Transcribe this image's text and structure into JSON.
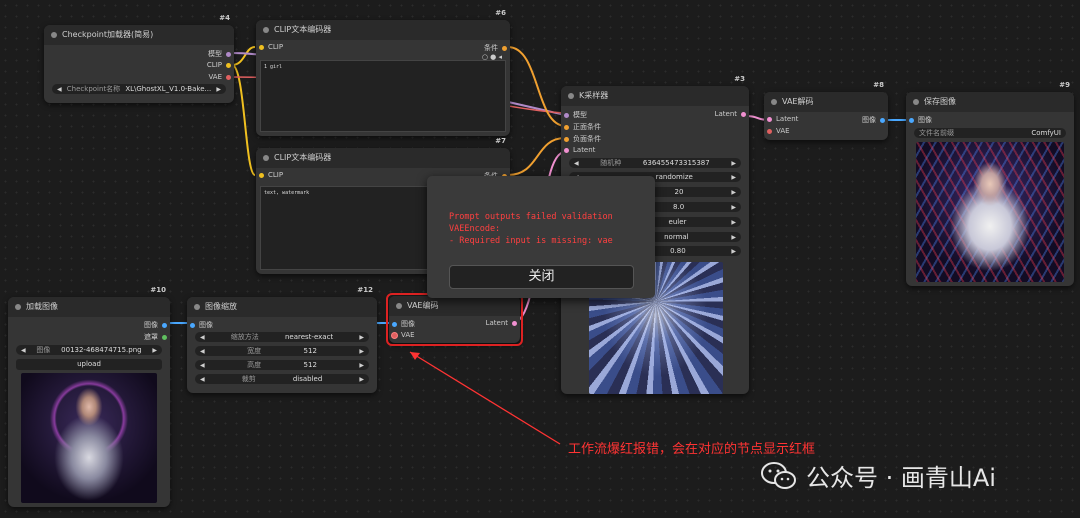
{
  "nodes": {
    "checkpoint": {
      "id": "#4",
      "title": "Checkpoint加载器(简易)",
      "outputs": [
        "模型",
        "CLIP",
        "VAE"
      ],
      "widget": {
        "label": "Checkpoint名称",
        "value": "XL\\GhostXL_V1.0-Bake..."
      }
    },
    "clip1": {
      "id": "#6",
      "title": "CLIP文本编码器",
      "input": "CLIP",
      "output": "条件",
      "text": "1 girl"
    },
    "clip2": {
      "id": "#7",
      "title": "CLIP文本编码器",
      "input": "CLIP",
      "output": "条件",
      "text": "text, watermark"
    },
    "ksampler": {
      "id": "#3",
      "title": "K采样器",
      "inputs": [
        "模型",
        "正面条件",
        "负面条件",
        "Latent"
      ],
      "output": "Latent",
      "widgets": [
        {
          "label": "随机种",
          "value": "636455473315387"
        },
        {
          "label": "",
          "value": "randomize"
        },
        {
          "label": "",
          "value": "20"
        },
        {
          "label": "",
          "value": "8.0"
        },
        {
          "label": "",
          "value": "euler"
        },
        {
          "label": "",
          "value": "normal"
        },
        {
          "label": "",
          "value": "0.80"
        }
      ]
    },
    "vaedecode": {
      "id": "#8",
      "title": "VAE解码",
      "inputs": [
        "Latent",
        "VAE"
      ],
      "output": "图像"
    },
    "saveimage": {
      "id": "#9",
      "title": "保存图像",
      "input": "图像",
      "widget": {
        "label": "文件名前缀",
        "value": "ComfyUI"
      }
    },
    "loadimage": {
      "id": "#10",
      "title": "加载图像",
      "outputs": [
        "图像",
        "遮罩"
      ],
      "widget": {
        "label": "图像",
        "value": "00132-468474715.png"
      },
      "upload": "upload"
    },
    "scale": {
      "id": "#12",
      "title": "图像缩放",
      "input": "图像",
      "widgets": [
        {
          "label": "缩放方法",
          "value": "nearest-exact"
        },
        {
          "label": "宽度",
          "value": "512"
        },
        {
          "label": "高度",
          "value": "512"
        },
        {
          "label": "裁剪",
          "value": "disabled"
        }
      ]
    },
    "vaeencode": {
      "id": "",
      "title": "VAE编码",
      "inputs": [
        "图像",
        "VAE"
      ],
      "output": "Latent"
    }
  },
  "error": {
    "lines": [
      "Prompt outputs failed validation",
      "VAEEncode:",
      "- Required input is missing: vae"
    ],
    "close_label": "关闭"
  },
  "annotation": "工作流爆红报错，会在对应的节点显示红框",
  "watermark": "公众号 · 画青山Ai",
  "colors": {
    "clip_wire": "#f0c020",
    "model_wire": "#b08ac8",
    "cond_wire": "#f0a030",
    "latent_wire": "#f090d0",
    "vae_wire": "#e06060",
    "image_wire": "#4aa8ff",
    "error": "#ff4040"
  }
}
